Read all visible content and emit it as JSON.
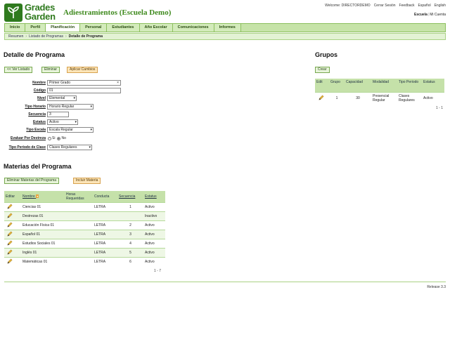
{
  "header": {
    "logo_line1": "Grades",
    "logo_line2": "Garden",
    "app_title": "Adiestramientos (Escuela Demo)",
    "welcome": "Welcome: DIRECTORDEMO",
    "links": [
      "Cerrar Sesión",
      "Feedback",
      "Español",
      "English"
    ],
    "school_label": "Escuela",
    "my_account": "Mi Cuenta"
  },
  "nav": {
    "tabs": [
      "Inicio",
      "Perfil",
      "Planificación",
      "Personal",
      "Estudiantes",
      "Año Escolar",
      "Comunicaciones",
      "Informes"
    ],
    "active": "Planificación"
  },
  "breadcrumb": [
    "Resumen",
    "Listado de Programas",
    "Detalle de Programa"
  ],
  "detail": {
    "title": "Detalle de Programa",
    "btn_back": "<< Ver Listado",
    "btn_delete": "Eliminar",
    "btn_apply": "Aplicar Cambios",
    "fields": {
      "nombre_label": "Nombre",
      "nombre_value": "Primer Grado",
      "codigo_label": "Código",
      "codigo_value": "01",
      "nivel_label": "Nivel",
      "nivel_value": "Elemental",
      "tipo_horario_label": "Tipo Horario",
      "tipo_horario_value": "Horario Regular",
      "secuencia_label": "Secuencia",
      "secuencia_value": "3",
      "estatus_label": "Estatus",
      "estatus_value": "Activo",
      "tipo_escala_label": "Tipo Escala",
      "tipo_escala_value": "Escala Regular",
      "evaluar_label": "Evaluar Por Destreza",
      "evaluar_si": "Si",
      "evaluar_no": "No",
      "tipo_periodo_label": "Tipo Periodo de Clase",
      "tipo_periodo_value": "Clases Regulares"
    }
  },
  "grupos": {
    "title": "Grupos",
    "btn_create": "Crear",
    "headers": [
      "Edit",
      "Grupo",
      "Capacidad",
      "Modalidad",
      "Tipo Periodo",
      "Estatus"
    ],
    "rows": [
      {
        "grupo": "1",
        "capacidad": "30",
        "modalidad": "Presencial Regular",
        "tipo_periodo": "Clases Regulares",
        "estatus": "Activo"
      }
    ],
    "pager": "1 - 1"
  },
  "materias": {
    "title": "Materias del Programa",
    "btn_remove": "Eliminar Materias del Programa",
    "btn_include": "Incluir Materia",
    "headers": [
      "Editar",
      "Nombre",
      "Horas Requeridas",
      "Conducta",
      "Secuencia",
      "Estatus"
    ],
    "rows": [
      {
        "nombre": "Ciencias 01",
        "horas": "",
        "conducta": "LETRA",
        "secuencia": "1",
        "estatus": "Activo"
      },
      {
        "nombre": "Destrezas 01",
        "horas": "",
        "conducta": "",
        "secuencia": "",
        "estatus": "Inactivo"
      },
      {
        "nombre": "Educación Física 01",
        "horas": "",
        "conducta": "LETRA",
        "secuencia": "2",
        "estatus": "Activo"
      },
      {
        "nombre": "Español 01",
        "horas": "",
        "conducta": "LETRA",
        "secuencia": "3",
        "estatus": "Activo"
      },
      {
        "nombre": "Estudios Sociales 01",
        "horas": "",
        "conducta": "LETRA",
        "secuencia": "4",
        "estatus": "Activo"
      },
      {
        "nombre": "Inglés 01",
        "horas": "",
        "conducta": "LETRA",
        "secuencia": "5",
        "estatus": "Activo"
      },
      {
        "nombre": "Matemáticas 01",
        "horas": "",
        "conducta": "LETRA",
        "secuencia": "6",
        "estatus": "Activo"
      }
    ],
    "pager": "1 - 7"
  },
  "footer": {
    "release": "Release 3.3"
  },
  "colors": {
    "brand_green": "#2f7a1e",
    "nav_bg": "#c6e3a8",
    "header_row": "#c5e1a9",
    "orange_btn": "#fde5b8"
  }
}
